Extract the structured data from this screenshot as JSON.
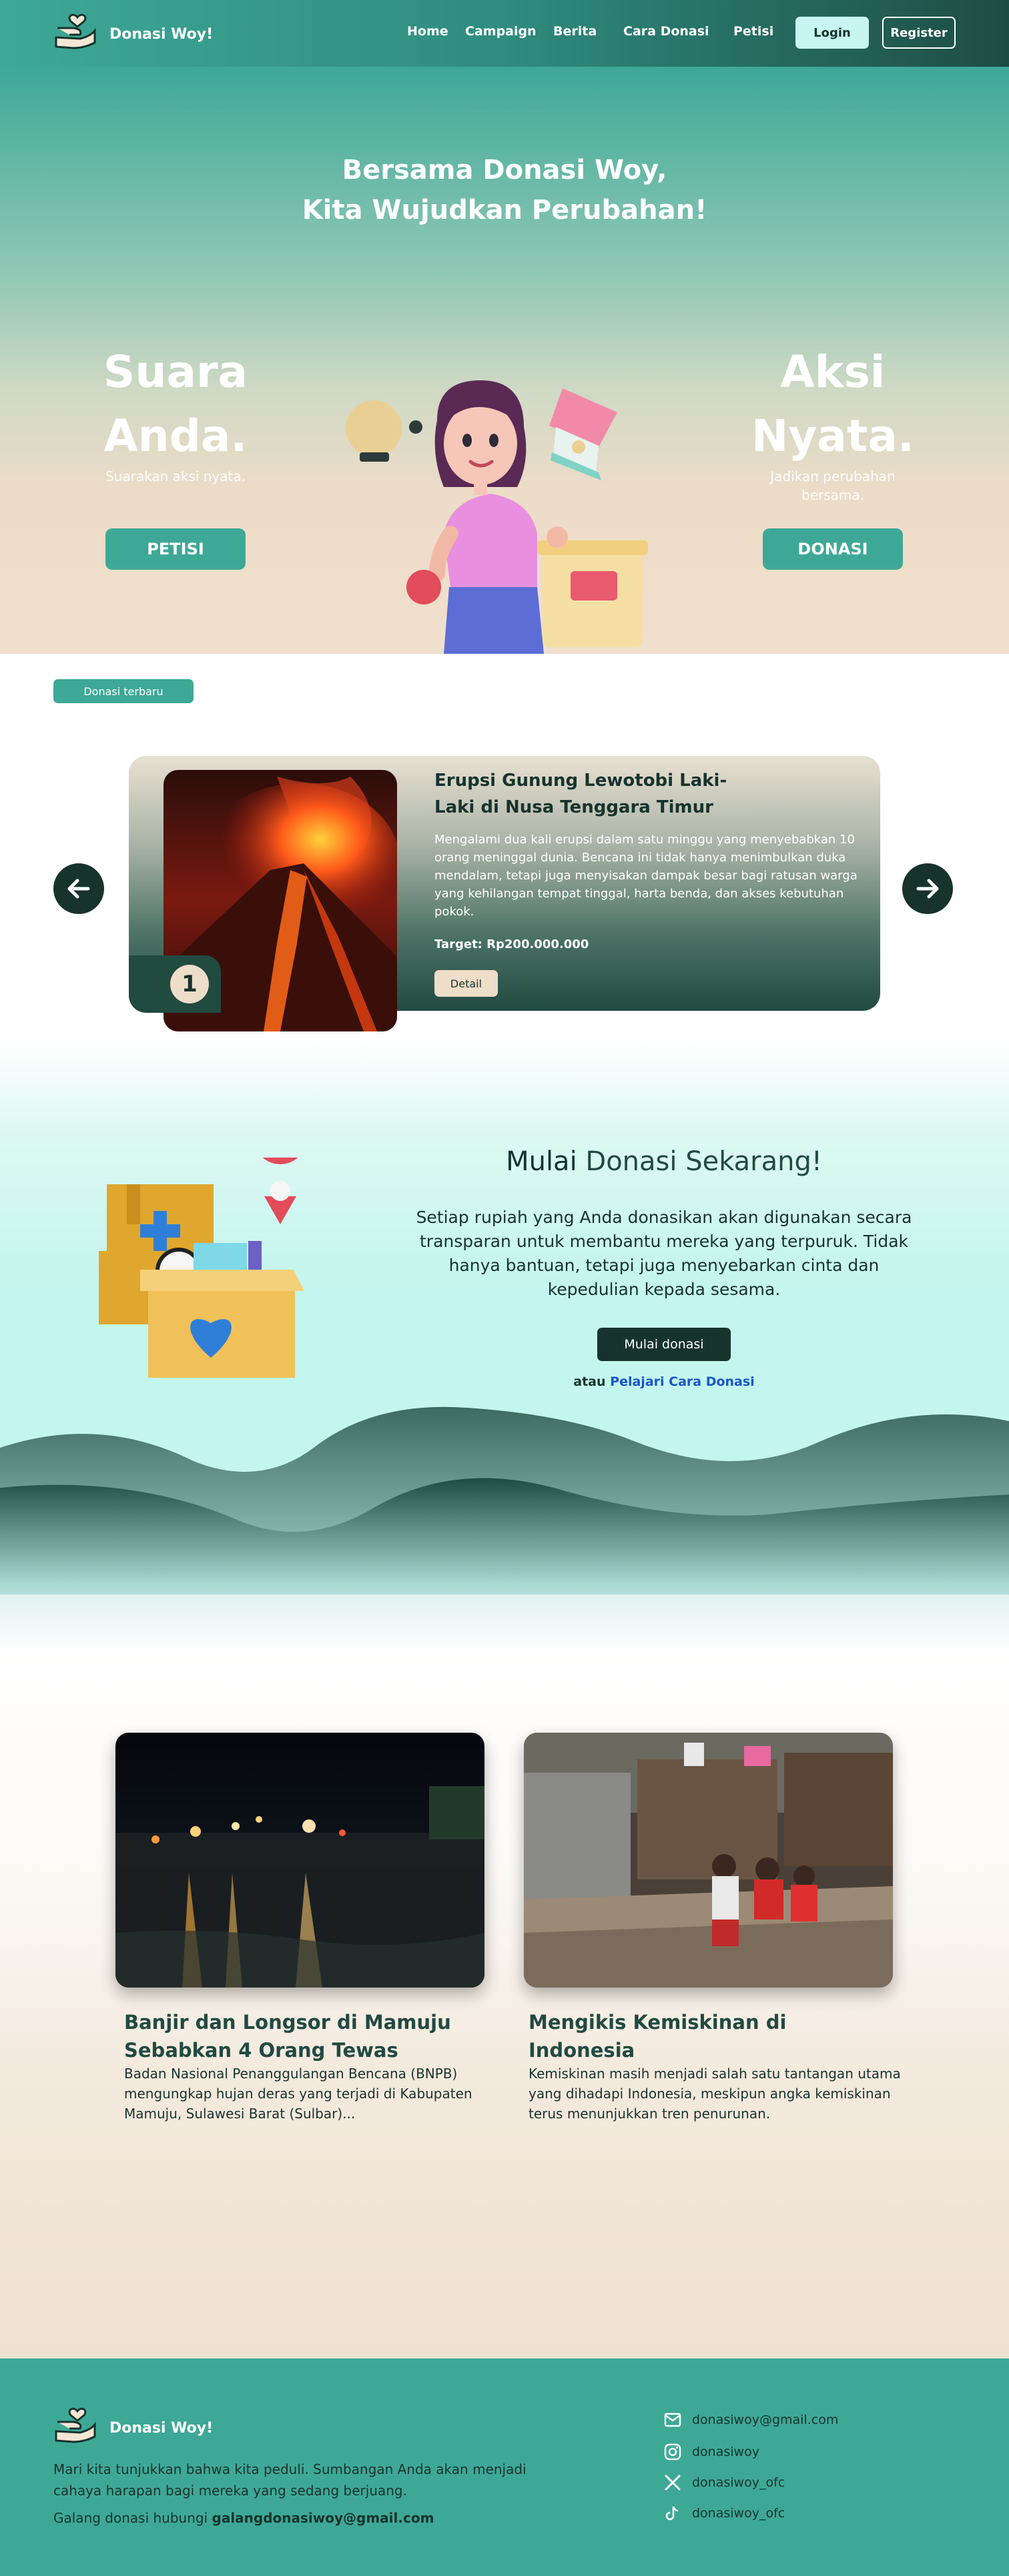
{
  "nav": {
    "brand": "Donasi Woy!",
    "links": [
      "Home",
      "Campaign",
      "Berita",
      "Cara Donasi",
      "Petisi"
    ],
    "login": "Login",
    "register": "Register"
  },
  "hero": {
    "title_line1": "Bersama Donasi Woy,",
    "title_line2": "Kita Wujudkan Perubahan!",
    "left": {
      "line1": "Suara",
      "line2": "Anda.",
      "sub": "Suarakan aksi nyata.",
      "button": "PETISI"
    },
    "right": {
      "line1": "Aksi",
      "line2": "Nyata.",
      "sub": "Jadikan perubahan bersama.",
      "button": "DONASI"
    }
  },
  "latest": {
    "pill": "Donasi terbaru",
    "card": {
      "number": "1",
      "title": "Erupsi Gunung Lewotobi Laki-Laki di Nusa Tenggara Timur",
      "description": "Mengalami dua kali erupsi dalam satu minggu yang menyebabkan 10 orang meninggal dunia. Bencana ini tidak hanya menimbulkan duka mendalam, tetapi juga menyisakan dampak besar bagi ratusan warga yang kehilangan tempat tinggal, harta benda, dan akses kebutuhan pokok.",
      "target": "Target: Rp200.000.000",
      "detail": "Detail"
    }
  },
  "start": {
    "title_a": "Mulai ",
    "title_b": "Donasi Sekarang!",
    "description": "Setiap rupiah yang Anda donasikan akan digunakan secara transparan untuk membantu mereka yang terpuruk. Tidak hanya bantuan, tetapi juga menyebarkan cinta dan kepedulian kepada sesama.",
    "button": "Mulai donasi",
    "or": "atau ",
    "link": "Pelajari Cara Donasi"
  },
  "news": [
    {
      "title": "Banjir dan Longsor di Mamuju Sebabkan 4 Orang Tewas",
      "description": "Badan Nasional Penanggulangan Bencana (BNPB) mengungkap hujan deras yang terjadi di Kabupaten Mamuju, Sulawesi Barat (Sulbar)..."
    },
    {
      "title": "Mengikis Kemiskinan di Indonesia",
      "description": "Kemiskinan masih menjadi salah satu tantangan utama yang dihadapi Indonesia, meskipun angka kemiskinan terus menunjukkan tren penurunan."
    }
  ],
  "footer": {
    "brand": "Donasi Woy!",
    "text": "Mari kita tunjukkan bahwa kita peduli. Sumbangan Anda akan menjadi cahaya harapan bagi mereka yang sedang berjuang.",
    "contact_prefix": "Galang donasi hubungi ",
    "contact_email": "galangdonasiwoy@gmail.com",
    "email": "donasiwoy@gmail.com",
    "instagram": "donasiwoy",
    "x": "donasiwoy_ofc",
    "tiktok": "donasiwoy_ofc"
  },
  "colors": {
    "primary": "#3ea897",
    "dark": "#17332d",
    "cream": "#eeddc8",
    "mint": "#c3f6ee",
    "link": "#1a56c8"
  },
  "icons": [
    "hand-heart-logo-icon",
    "arrow-left-icon",
    "arrow-right-icon",
    "mail-icon",
    "instagram-icon",
    "x-icon",
    "tiktok-icon"
  ]
}
